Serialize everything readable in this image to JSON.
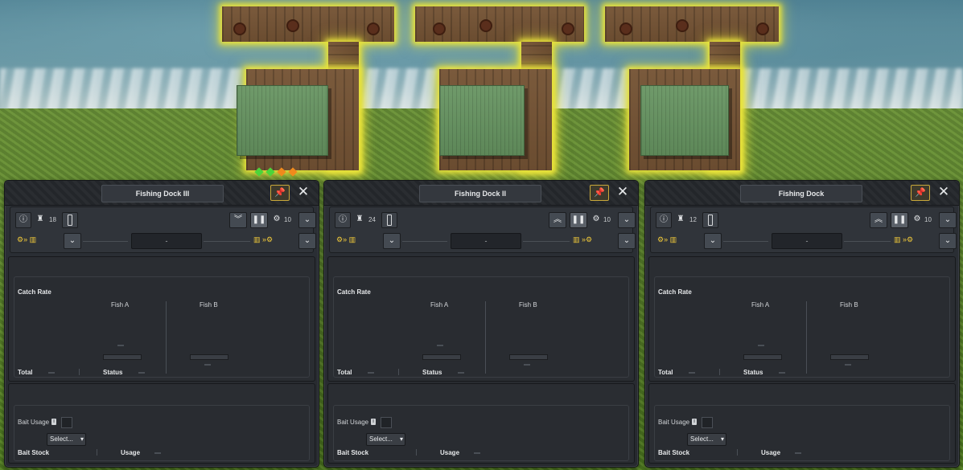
{
  "panels": [
    {
      "title": "Fishing Dock III",
      "workers_count": "18",
      "has_gear_count": false,
      "gear_count": "",
      "collapse_icon": "double-chevron-down-icon",
      "mid_value": "-",
      "catch": {
        "heading": "Catch Rate",
        "col_a": "Fish A",
        "col_b": "Fish B",
        "total": "Total",
        "status": "Status"
      },
      "bait": {
        "usage": "Bait Usage",
        "select": "Select...",
        "stock": "Bait Stock",
        "usage_col": "Usage"
      }
    },
    {
      "title": "Fishing Dock II",
      "workers_count": "24",
      "has_gear_count": true,
      "gear_count": "10",
      "collapse_icon": "double-chevron-up-icon",
      "mid_value": "-",
      "catch": {
        "heading": "Catch Rate",
        "col_a": "Fish A",
        "col_b": "Fish B",
        "total": "Total",
        "status": "Status"
      },
      "bait": {
        "usage": "Bait Usage",
        "select": "Select...",
        "stock": "Bait Stock",
        "usage_col": "Usage"
      }
    },
    {
      "title": "Fishing Dock",
      "workers_count": "12",
      "has_gear_count": true,
      "gear_count": "10",
      "collapse_icon": "double-chevron-up-icon",
      "mid_value": "-",
      "catch": {
        "heading": "Catch Rate",
        "col_a": "Fish A",
        "col_b": "Fish B",
        "total": "Total",
        "status": "Status"
      },
      "bait": {
        "usage": "Bait Usage",
        "select": "Select...",
        "stock": "Bait Stock",
        "usage_col": "Usage"
      }
    }
  ],
  "panel0_gear_count": "10",
  "colors": {
    "accent_gold": "#f0c93a",
    "panel_bg": "#2c3036",
    "selection_glow": "#e8e23a",
    "marker_green": "#4cd43a",
    "marker_orange": "#f08a1c"
  },
  "icons": {
    "info": "info-icon",
    "workers": "worker-icon",
    "pause": "pause-icon",
    "gear": "gear-icon",
    "dropdown": "chevron-down-icon",
    "input_flow": "input-goods-to-factory-icon",
    "output_flow": "factory-to-output-goods-icon",
    "pin": "pin-icon",
    "close": "close-icon"
  }
}
